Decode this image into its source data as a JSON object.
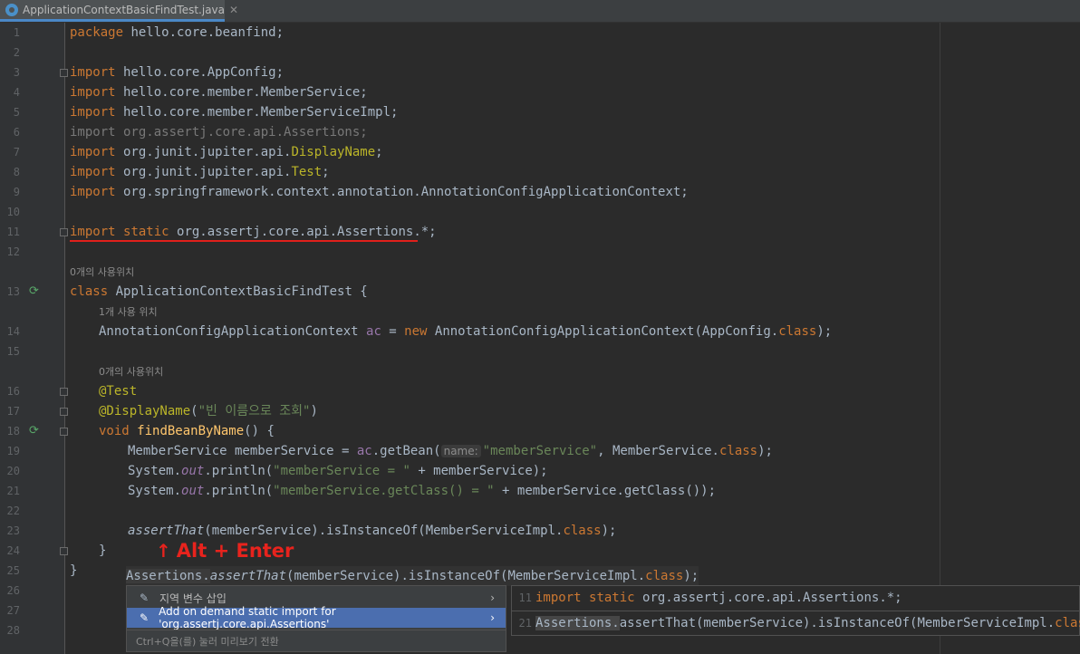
{
  "tab": {
    "title": "ApplicationContextBasicFindTest.java",
    "close": "✕"
  },
  "lines": [
    "1",
    "2",
    "3",
    "4",
    "5",
    "6",
    "7",
    "8",
    "9",
    "10",
    "11",
    "12",
    "13",
    "14",
    "15",
    "16",
    "17",
    "18",
    "19",
    "20",
    "21",
    "22",
    "23",
    "24",
    "25",
    "26",
    "27",
    "28"
  ],
  "code": {
    "l1": {
      "kw": "package",
      "rest": " hello.core.beanfind;"
    },
    "l3": {
      "kw": "import",
      "rest": " hello.core.AppConfig;"
    },
    "l4": {
      "kw": "import",
      "rest": " hello.core.member.MemberService;"
    },
    "l5": {
      "kw": "import",
      "rest": " hello.core.member.MemberServiceImpl;"
    },
    "l6": "import org.assertj.core.api.Assertions;",
    "l7": {
      "kw": "import",
      "rest": " org.junit.jupiter.api.",
      "ann": "DisplayName",
      "end": ";"
    },
    "l8": {
      "kw": "import",
      "rest": " org.junit.jupiter.api.",
      "ann": "Test",
      "end": ";"
    },
    "l9": {
      "kw": "import",
      "rest": " org.springframework.context.annotation.AnnotationConfigApplicationContext;"
    },
    "l11": {
      "kw1": "import",
      "kw2": "static",
      "rest": " org.assertj.core.api.Assertions.*;"
    },
    "hint_usage_1": "0개의 사용위치",
    "l13": {
      "kw": "class",
      "rest": " ApplicationContextBasicFindTest {"
    },
    "hint_usage_2": "1개 사용 위치",
    "l14": {
      "a": "AnnotationConfigApplicationContext ",
      "b": "ac",
      "c": " = ",
      "d": "new",
      "e": " AnnotationConfigApplicationContext(AppConfig.",
      "f": "class",
      "g": ");"
    },
    "hint_usage_3": "0개의 사용위치",
    "l16": "@Test",
    "l17": {
      "ann": "@DisplayName",
      "open": "(",
      "str": "\"빈 이름으로 조회\"",
      "close": ")"
    },
    "l18": {
      "kw": "void",
      "fn": "findBeanByName",
      "rest": "() {"
    },
    "l19": {
      "a": "MemberService memberService = ",
      "b": "ac",
      "c": ".getBean(",
      "hint": "name:",
      "str": "\"memberService\"",
      "d": ", MemberService.",
      "kw": "class",
      "e": ");"
    },
    "l20": {
      "a": "System.",
      "fld": "out",
      "b": ".println(",
      "str": "\"memberService = \"",
      "c": " + memberService);"
    },
    "l21": {
      "a": "System.",
      "fld": "out",
      "b": ".println(",
      "str": "\"memberService.getClass() = \"",
      "c": " + memberService.getClass());"
    },
    "l23": {
      "it": "assertThat",
      "a": "(memberService).isInstanceOf(MemberServiceImpl.",
      "kw": "class",
      "b": ");"
    },
    "l24": "}",
    "l25a": "}",
    "l25b": {
      "a": "Assertions.",
      "it": "assertThat",
      "b": "(memberService).isInstanceOf(MemberServiceImpl.",
      "kw": "class",
      "c": ");"
    }
  },
  "annotation": {
    "arrow": "↑",
    "text": "Alt + Enter"
  },
  "menu": {
    "item1": "지역 변수 삽입",
    "item2": "Add on demand static import for 'org.assertj.core.api.Assertions'",
    "submenu": "›",
    "footer": "Ctrl+Q을(를) 눌러 미리보기 전환"
  },
  "preview": {
    "line1": {
      "num": "11",
      "kw1": "import",
      "kw2": "static",
      "rest": " org.assertj.core.api.Assertions.*;"
    },
    "line2": {
      "num": "21",
      "hl": "Assertions.",
      "rest": "assertThat(memberService).isInstanceOf(MemberServiceImpl.",
      "kw": "class",
      "end": ");"
    }
  },
  "colors": {
    "background": "#2b2b2b",
    "keyword": "#cc7832",
    "annotation": "#bbb529",
    "string": "#6a8759",
    "selection": "#4b6eaf",
    "underline": "#e0201b"
  }
}
